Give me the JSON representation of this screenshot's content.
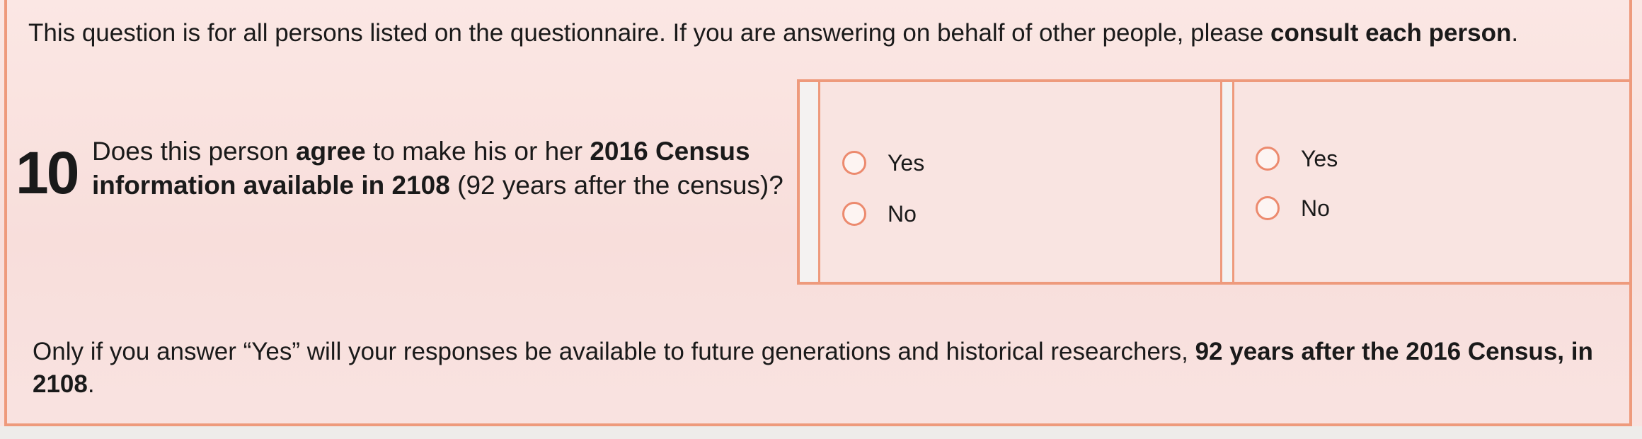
{
  "intro": {
    "text": "This question is for all persons listed on the questionnaire. If you are answering on behalf of other people, please ",
    "emphasis": "consult each person",
    "end": "."
  },
  "question": {
    "number": "10",
    "part1": "Does this person ",
    "bold1": "agree",
    "part2": " to make his or her ",
    "bold2": "2016 Census information available in 2108",
    "part3": " (92 years after the census)?"
  },
  "answer_columns": [
    {
      "options": [
        "Yes",
        "No"
      ]
    },
    {
      "options": [
        "Yes",
        "No"
      ]
    }
  ],
  "footer": {
    "text": "Only if you answer “Yes” will your responses be available to future generations and historical researchers, ",
    "emphasis": "92 years after the 2016 Census, in 2108",
    "end": "."
  },
  "colors": {
    "border": "#ee9a7c",
    "radio": "#ec8a6e",
    "paper": "#f9e4e1"
  }
}
